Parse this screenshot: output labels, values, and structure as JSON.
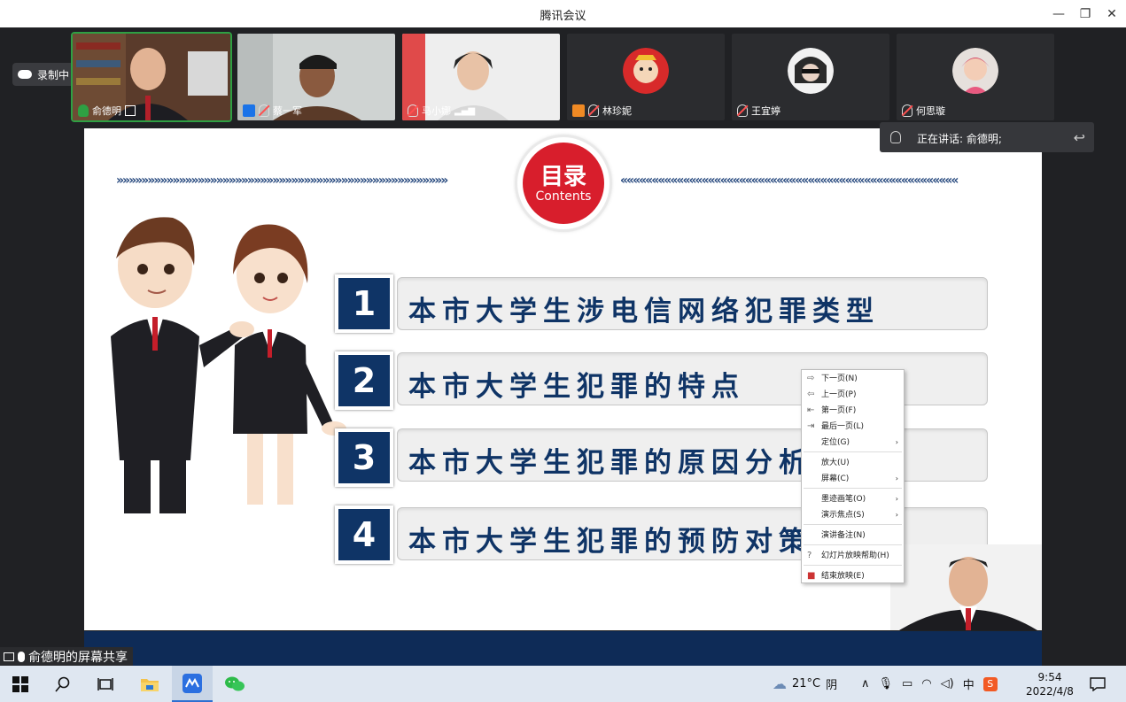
{
  "window": {
    "title": "腾讯会议",
    "minimize_icon": "—",
    "restore_icon": "❐",
    "close_icon": "✕"
  },
  "recording": {
    "label": "录制中"
  },
  "participants": [
    {
      "name": "俞德明",
      "active": true
    },
    {
      "name": "蔡一军",
      "active": false
    },
    {
      "name": "马小娜",
      "active": false
    },
    {
      "name": "林珍妮",
      "active": false
    },
    {
      "name": "王宜婷",
      "active": false
    },
    {
      "name": "何思璇",
      "active": false
    }
  ],
  "speaking": {
    "prefix": "正在讲话: ",
    "name": "俞德明;"
  },
  "slide": {
    "badge_zh": "目录",
    "badge_en": "Contents",
    "items": [
      {
        "num": "1",
        "text": "本市大学生涉电信网络犯罪类型"
      },
      {
        "num": "2",
        "text": "本市大学生犯罪的特点"
      },
      {
        "num": "3",
        "text": "本市大学生犯罪的原因分析"
      },
      {
        "num": "4",
        "text": "本市大学生犯罪的预防对策"
      }
    ]
  },
  "context_menu": {
    "items": [
      {
        "label": "下一页(N)",
        "icon": "⇨"
      },
      {
        "label": "上一页(P)",
        "icon": "⇦"
      },
      {
        "label": "第一页(F)",
        "icon": "⇤"
      },
      {
        "label": "最后一页(L)",
        "icon": "⇥"
      },
      {
        "label": "定位(G)",
        "submenu": true
      },
      {
        "label": "放大(U)"
      },
      {
        "label": "屏幕(C)",
        "submenu": true
      },
      {
        "label": "墨迹画笔(O)",
        "submenu": true
      },
      {
        "label": "演示焦点(S)",
        "submenu": true
      },
      {
        "label": "演讲备注(N)"
      },
      {
        "label": "幻灯片放映帮助(H)",
        "icon": "?"
      },
      {
        "label": "结束放映(E)",
        "icon": "■"
      }
    ]
  },
  "screen_share": {
    "label": "俞德明的屏幕共享"
  },
  "taskbar": {
    "weather_temp": "21°C",
    "weather_text": "阴",
    "ime": "中",
    "time": "9:54",
    "date": "2022/4/8"
  }
}
